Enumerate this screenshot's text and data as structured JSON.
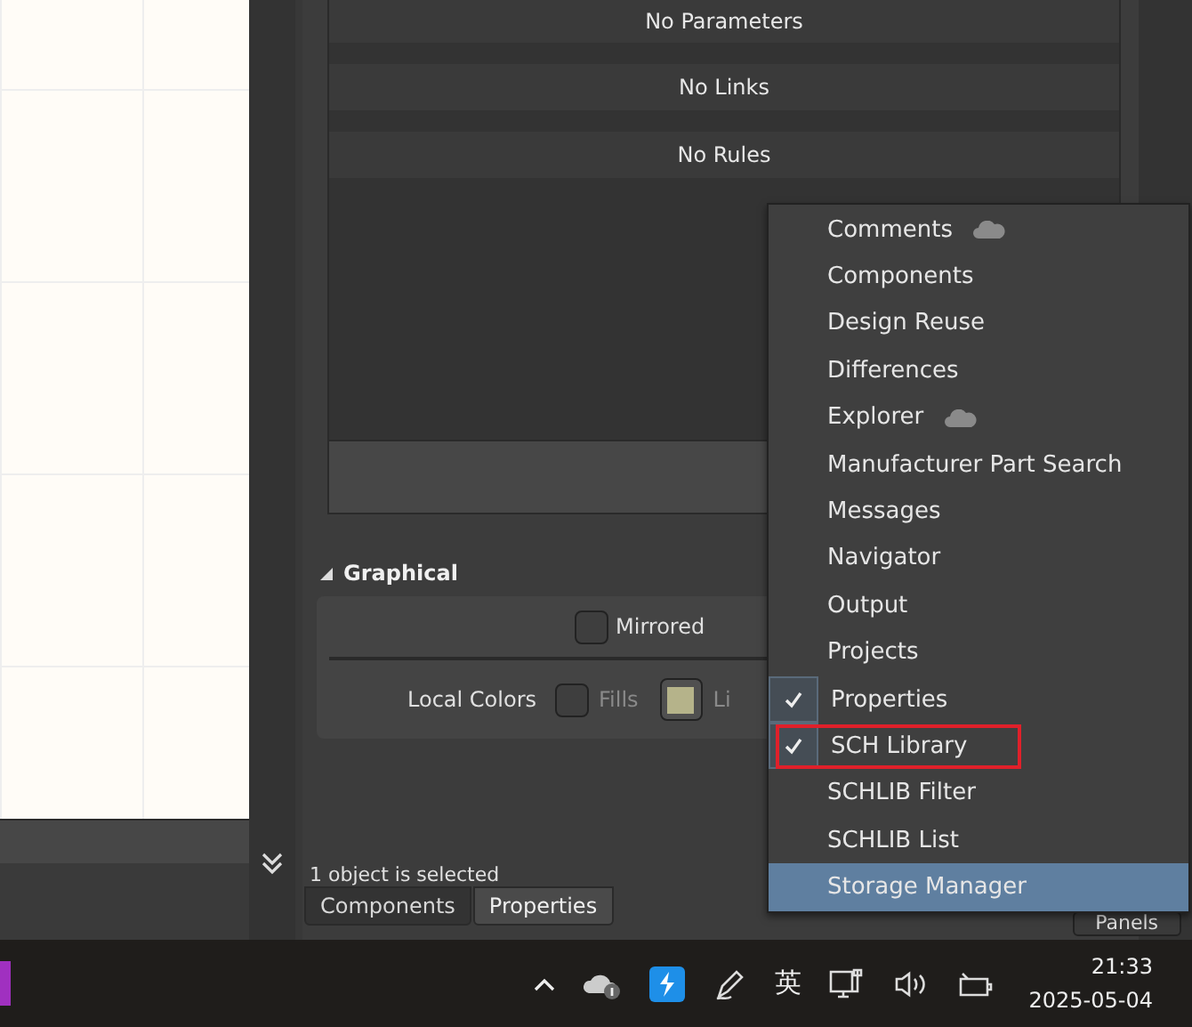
{
  "panel": {
    "rows": [
      "No Parameters",
      "No Links",
      "No Rules"
    ],
    "section": {
      "title": "Graphical",
      "expanded": true
    },
    "mirrored": {
      "label": "Mirrored",
      "checked": false
    },
    "local_colors": {
      "label": "Local Colors",
      "fills": {
        "label": "Fills",
        "checked": false
      },
      "lines_label": "Li"
    },
    "status": "1 object is selected",
    "tabs": [
      {
        "label": "Components",
        "selected": false
      },
      {
        "label": "Properties",
        "selected": true
      }
    ],
    "panels_button": "Panels"
  },
  "menu": [
    {
      "label": "Comments",
      "checked": false,
      "cloud": true,
      "selected": false,
      "outlined": false
    },
    {
      "label": "Components",
      "checked": false,
      "cloud": false,
      "selected": false,
      "outlined": false
    },
    {
      "label": "Design Reuse",
      "checked": false,
      "cloud": false,
      "selected": false,
      "outlined": false
    },
    {
      "label": "Differences",
      "checked": false,
      "cloud": false,
      "selected": false,
      "outlined": false
    },
    {
      "label": "Explorer",
      "checked": false,
      "cloud": true,
      "selected": false,
      "outlined": false
    },
    {
      "label": "Manufacturer Part Search",
      "checked": false,
      "cloud": false,
      "selected": false,
      "outlined": false
    },
    {
      "label": "Messages",
      "checked": false,
      "cloud": false,
      "selected": false,
      "outlined": false
    },
    {
      "label": "Navigator",
      "checked": false,
      "cloud": false,
      "selected": false,
      "outlined": false
    },
    {
      "label": "Output",
      "checked": false,
      "cloud": false,
      "selected": false,
      "outlined": false
    },
    {
      "label": "Projects",
      "checked": false,
      "cloud": false,
      "selected": false,
      "outlined": false
    },
    {
      "label": "Properties",
      "checked": true,
      "cloud": false,
      "selected": false,
      "outlined": false
    },
    {
      "label": "SCH Library",
      "checked": true,
      "cloud": false,
      "selected": false,
      "outlined": true
    },
    {
      "label": "SCHLIB Filter",
      "checked": false,
      "cloud": false,
      "selected": false,
      "outlined": false
    },
    {
      "label": "SCHLIB List",
      "checked": false,
      "cloud": false,
      "selected": false,
      "outlined": false
    },
    {
      "label": "Storage Manager",
      "checked": false,
      "cloud": false,
      "selected": true,
      "outlined": false
    }
  ],
  "taskbar": {
    "ime": "英",
    "time": "21:33",
    "date": "2025-05-04"
  }
}
